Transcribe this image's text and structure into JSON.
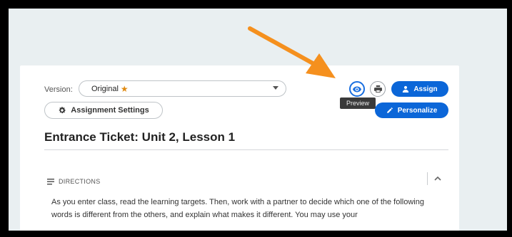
{
  "version": {
    "label": "Version:",
    "selected": "Original",
    "badge_icon": "star-icon"
  },
  "toolbar": {
    "settings_label": "Assignment Settings",
    "preview_tooltip": "Preview",
    "assign_label": "Assign",
    "personalize_label": "Personalize"
  },
  "lesson": {
    "title": "Entrance Ticket: Unit 2, Lesson 1"
  },
  "directions": {
    "heading": "DIRECTIONS",
    "text": "As you enter class, read the learning targets. Then, work with a partner to decide which one of the following words is different from the others, and explain what makes it different. You may use your"
  },
  "colors": {
    "accent": "#0b66d8",
    "annotation_arrow": "#f5901e",
    "star": "#e08a12"
  }
}
